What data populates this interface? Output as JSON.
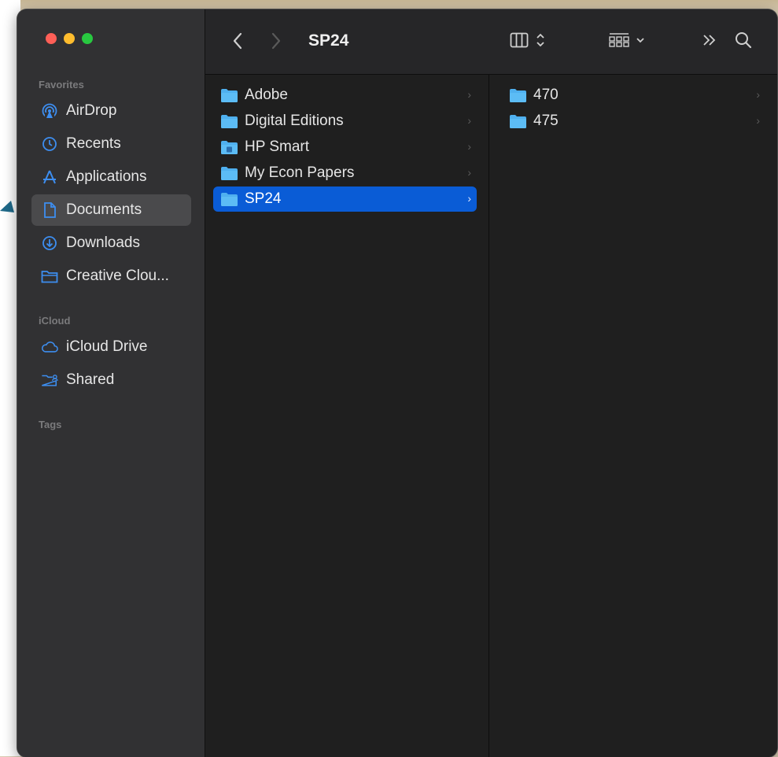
{
  "window": {
    "title": "SP24"
  },
  "sidebar": {
    "favorites_heading": "Favorites",
    "favorites": [
      {
        "label": "AirDrop",
        "icon": "airdrop-icon",
        "selected": false
      },
      {
        "label": "Recents",
        "icon": "clock-icon",
        "selected": false
      },
      {
        "label": "Applications",
        "icon": "applications-icon",
        "selected": false
      },
      {
        "label": "Documents",
        "icon": "document-icon",
        "selected": true
      },
      {
        "label": "Downloads",
        "icon": "download-icon",
        "selected": false
      },
      {
        "label": "Creative Clou...",
        "icon": "folder-outline-icon",
        "selected": false
      }
    ],
    "icloud_heading": "iCloud",
    "icloud": [
      {
        "label": "iCloud Drive",
        "icon": "cloud-icon",
        "selected": false
      },
      {
        "label": "Shared",
        "icon": "shared-folder-icon",
        "selected": false
      }
    ],
    "tags_heading": "Tags"
  },
  "toolbar": {
    "back_icon": "chevron-left-icon",
    "forward_icon": "chevron-right-icon",
    "view_icon": "column-view-icon",
    "group_icon": "group-grid-icon",
    "overflow_icon": "double-chevron-right-icon",
    "search_icon": "search-icon"
  },
  "column1": {
    "items": [
      {
        "label": "Adobe",
        "icon": "folder-icon",
        "selected": false
      },
      {
        "label": "Digital Editions",
        "icon": "folder-icon",
        "selected": false
      },
      {
        "label": "HP Smart",
        "icon": "app-folder-icon",
        "selected": false
      },
      {
        "label": "My Econ Papers",
        "icon": "folder-icon",
        "selected": false
      },
      {
        "label": "SP24",
        "icon": "folder-icon",
        "selected": true
      }
    ]
  },
  "column2": {
    "items": [
      {
        "label": "470",
        "icon": "folder-icon",
        "selected": false
      },
      {
        "label": "475",
        "icon": "folder-icon",
        "selected": false
      }
    ]
  },
  "colors": {
    "accent": "#0a5cd6",
    "folder_blue": "#4fb0ef",
    "sidebar_icon": "#3d8ef0",
    "sidebar_bg": "#313133",
    "content_bg": "#1f1f1f"
  }
}
